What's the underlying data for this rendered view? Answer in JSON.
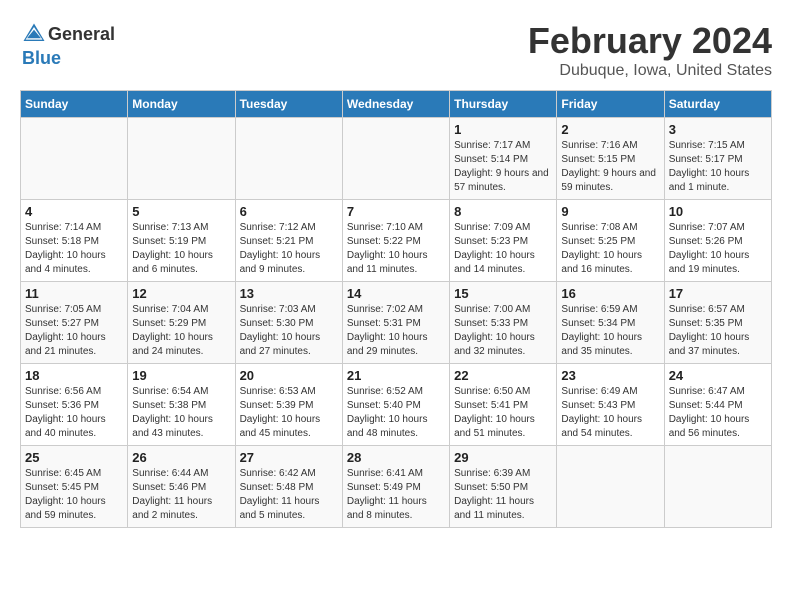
{
  "header": {
    "logo_general": "General",
    "logo_blue": "Blue",
    "month_year": "February 2024",
    "location": "Dubuque, Iowa, United States"
  },
  "days_of_week": [
    "Sunday",
    "Monday",
    "Tuesday",
    "Wednesday",
    "Thursday",
    "Friday",
    "Saturday"
  ],
  "weeks": [
    [
      {
        "day": "",
        "sunrise": "",
        "sunset": "",
        "daylight": ""
      },
      {
        "day": "",
        "sunrise": "",
        "sunset": "",
        "daylight": ""
      },
      {
        "day": "",
        "sunrise": "",
        "sunset": "",
        "daylight": ""
      },
      {
        "day": "",
        "sunrise": "",
        "sunset": "",
        "daylight": ""
      },
      {
        "day": "1",
        "sunrise": "Sunrise: 7:17 AM",
        "sunset": "Sunset: 5:14 PM",
        "daylight": "Daylight: 9 hours and 57 minutes."
      },
      {
        "day": "2",
        "sunrise": "Sunrise: 7:16 AM",
        "sunset": "Sunset: 5:15 PM",
        "daylight": "Daylight: 9 hours and 59 minutes."
      },
      {
        "day": "3",
        "sunrise": "Sunrise: 7:15 AM",
        "sunset": "Sunset: 5:17 PM",
        "daylight": "Daylight: 10 hours and 1 minute."
      }
    ],
    [
      {
        "day": "4",
        "sunrise": "Sunrise: 7:14 AM",
        "sunset": "Sunset: 5:18 PM",
        "daylight": "Daylight: 10 hours and 4 minutes."
      },
      {
        "day": "5",
        "sunrise": "Sunrise: 7:13 AM",
        "sunset": "Sunset: 5:19 PM",
        "daylight": "Daylight: 10 hours and 6 minutes."
      },
      {
        "day": "6",
        "sunrise": "Sunrise: 7:12 AM",
        "sunset": "Sunset: 5:21 PM",
        "daylight": "Daylight: 10 hours and 9 minutes."
      },
      {
        "day": "7",
        "sunrise": "Sunrise: 7:10 AM",
        "sunset": "Sunset: 5:22 PM",
        "daylight": "Daylight: 10 hours and 11 minutes."
      },
      {
        "day": "8",
        "sunrise": "Sunrise: 7:09 AM",
        "sunset": "Sunset: 5:23 PM",
        "daylight": "Daylight: 10 hours and 14 minutes."
      },
      {
        "day": "9",
        "sunrise": "Sunrise: 7:08 AM",
        "sunset": "Sunset: 5:25 PM",
        "daylight": "Daylight: 10 hours and 16 minutes."
      },
      {
        "day": "10",
        "sunrise": "Sunrise: 7:07 AM",
        "sunset": "Sunset: 5:26 PM",
        "daylight": "Daylight: 10 hours and 19 minutes."
      }
    ],
    [
      {
        "day": "11",
        "sunrise": "Sunrise: 7:05 AM",
        "sunset": "Sunset: 5:27 PM",
        "daylight": "Daylight: 10 hours and 21 minutes."
      },
      {
        "day": "12",
        "sunrise": "Sunrise: 7:04 AM",
        "sunset": "Sunset: 5:29 PM",
        "daylight": "Daylight: 10 hours and 24 minutes."
      },
      {
        "day": "13",
        "sunrise": "Sunrise: 7:03 AM",
        "sunset": "Sunset: 5:30 PM",
        "daylight": "Daylight: 10 hours and 27 minutes."
      },
      {
        "day": "14",
        "sunrise": "Sunrise: 7:02 AM",
        "sunset": "Sunset: 5:31 PM",
        "daylight": "Daylight: 10 hours and 29 minutes."
      },
      {
        "day": "15",
        "sunrise": "Sunrise: 7:00 AM",
        "sunset": "Sunset: 5:33 PM",
        "daylight": "Daylight: 10 hours and 32 minutes."
      },
      {
        "day": "16",
        "sunrise": "Sunrise: 6:59 AM",
        "sunset": "Sunset: 5:34 PM",
        "daylight": "Daylight: 10 hours and 35 minutes."
      },
      {
        "day": "17",
        "sunrise": "Sunrise: 6:57 AM",
        "sunset": "Sunset: 5:35 PM",
        "daylight": "Daylight: 10 hours and 37 minutes."
      }
    ],
    [
      {
        "day": "18",
        "sunrise": "Sunrise: 6:56 AM",
        "sunset": "Sunset: 5:36 PM",
        "daylight": "Daylight: 10 hours and 40 minutes."
      },
      {
        "day": "19",
        "sunrise": "Sunrise: 6:54 AM",
        "sunset": "Sunset: 5:38 PM",
        "daylight": "Daylight: 10 hours and 43 minutes."
      },
      {
        "day": "20",
        "sunrise": "Sunrise: 6:53 AM",
        "sunset": "Sunset: 5:39 PM",
        "daylight": "Daylight: 10 hours and 45 minutes."
      },
      {
        "day": "21",
        "sunrise": "Sunrise: 6:52 AM",
        "sunset": "Sunset: 5:40 PM",
        "daylight": "Daylight: 10 hours and 48 minutes."
      },
      {
        "day": "22",
        "sunrise": "Sunrise: 6:50 AM",
        "sunset": "Sunset: 5:41 PM",
        "daylight": "Daylight: 10 hours and 51 minutes."
      },
      {
        "day": "23",
        "sunrise": "Sunrise: 6:49 AM",
        "sunset": "Sunset: 5:43 PM",
        "daylight": "Daylight: 10 hours and 54 minutes."
      },
      {
        "day": "24",
        "sunrise": "Sunrise: 6:47 AM",
        "sunset": "Sunset: 5:44 PM",
        "daylight": "Daylight: 10 hours and 56 minutes."
      }
    ],
    [
      {
        "day": "25",
        "sunrise": "Sunrise: 6:45 AM",
        "sunset": "Sunset: 5:45 PM",
        "daylight": "Daylight: 10 hours and 59 minutes."
      },
      {
        "day": "26",
        "sunrise": "Sunrise: 6:44 AM",
        "sunset": "Sunset: 5:46 PM",
        "daylight": "Daylight: 11 hours and 2 minutes."
      },
      {
        "day": "27",
        "sunrise": "Sunrise: 6:42 AM",
        "sunset": "Sunset: 5:48 PM",
        "daylight": "Daylight: 11 hours and 5 minutes."
      },
      {
        "day": "28",
        "sunrise": "Sunrise: 6:41 AM",
        "sunset": "Sunset: 5:49 PM",
        "daylight": "Daylight: 11 hours and 8 minutes."
      },
      {
        "day": "29",
        "sunrise": "Sunrise: 6:39 AM",
        "sunset": "Sunset: 5:50 PM",
        "daylight": "Daylight: 11 hours and 11 minutes."
      },
      {
        "day": "",
        "sunrise": "",
        "sunset": "",
        "daylight": ""
      },
      {
        "day": "",
        "sunrise": "",
        "sunset": "",
        "daylight": ""
      }
    ]
  ]
}
